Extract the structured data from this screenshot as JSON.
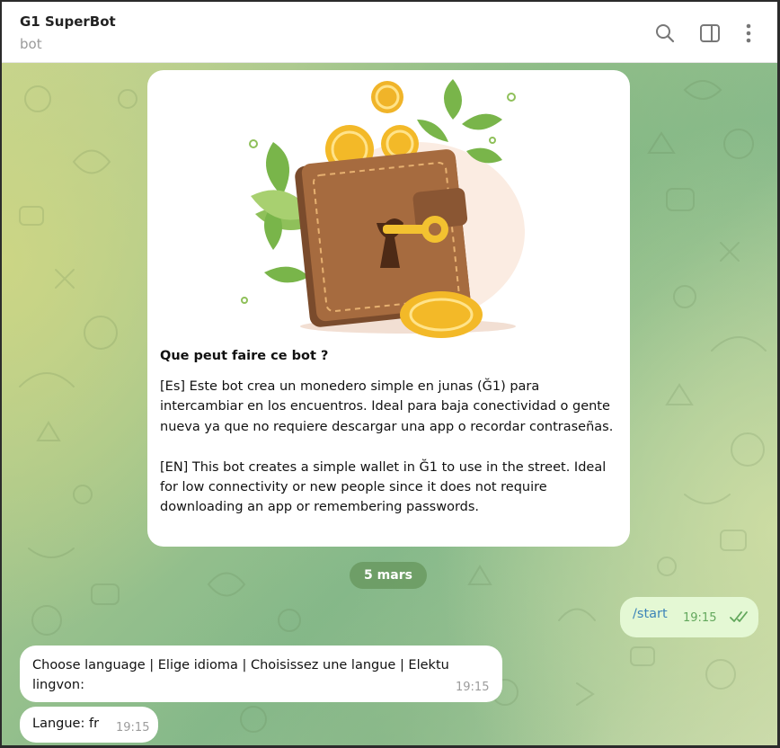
{
  "header": {
    "title": "G1 SuperBot",
    "subtitle": "bot",
    "icons": [
      "search-icon",
      "sidebar-toggle-icon",
      "more-vertical-icon"
    ]
  },
  "intro_card": {
    "illustration": "wallet-with-coins-and-key",
    "title": "Que peut faire ce bot ?",
    "body": "[Es] Este bot crea un monedero simple en junas (Ğ1) para intercambiar en los encuentros. Ideal para baja conectividad o gente nueva ya que no requiere descargar una app o recordar contraseñas.\n\n[EN] This bot creates a simple wallet in Ğ1 to use in the street. Ideal for low connectivity or new people since it does not require downloading an app or remembering passwords."
  },
  "date_separator": "5 mars",
  "messages": [
    {
      "direction": "out",
      "text": "/start",
      "time": "19:15",
      "status": "read"
    },
    {
      "direction": "in",
      "text": "Choose language | Elige idioma | Choisissez une langue | Elektu lingvon:",
      "time": "19:15"
    },
    {
      "direction": "in",
      "text": "Langue: fr",
      "time": "19:15"
    }
  ],
  "colors": {
    "accent_link": "#3c84b8",
    "outgoing_bubble": "#e4f8d4",
    "read_check": "#62a75c",
    "date_pill": "#69985f"
  }
}
